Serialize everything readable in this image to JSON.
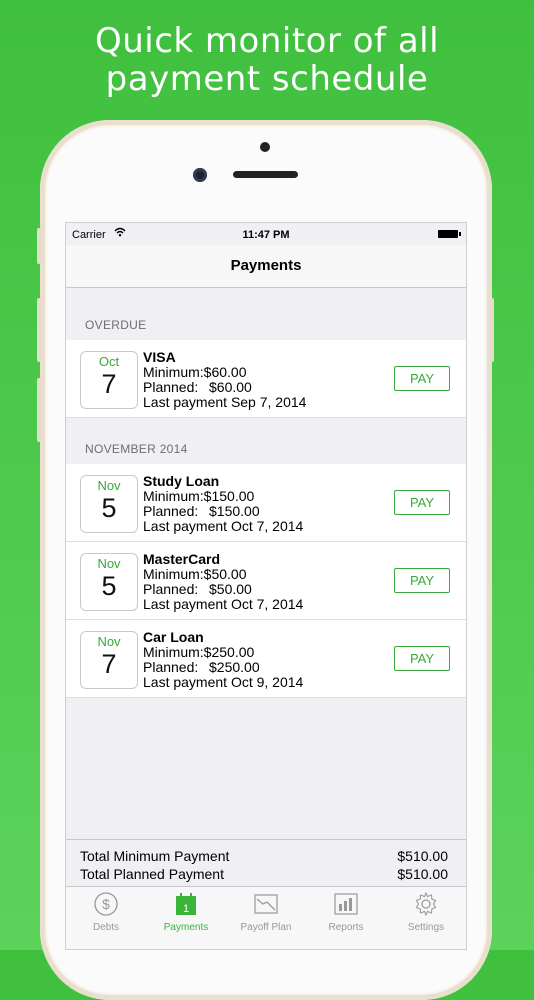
{
  "headline": [
    "Quick monitor of all",
    "payment schedule"
  ],
  "status": {
    "carrier": "Carrier",
    "time": "11:47 PM"
  },
  "nav_title": "Payments",
  "sections": [
    {
      "header": "OVERDUE",
      "items": [
        {
          "month": "Oct",
          "day": "7",
          "name": "VISA",
          "min_label": "Minimum:",
          "min": "$60.00",
          "plan_label": "Planned:",
          "plan": "$60.00",
          "last": "Last payment Sep 7, 2014",
          "pay": "PAY"
        }
      ]
    },
    {
      "header": "NOVEMBER 2014",
      "items": [
        {
          "month": "Nov",
          "day": "5",
          "name": "Study Loan",
          "min_label": "Minimum:",
          "min": "$150.00",
          "plan_label": "Planned:",
          "plan": "$150.00",
          "last": "Last payment Oct 7, 2014",
          "pay": "PAY"
        },
        {
          "month": "Nov",
          "day": "5",
          "name": "MasterCard",
          "min_label": "Minimum:",
          "min": "$50.00",
          "plan_label": "Planned:",
          "plan": "$50.00",
          "last": "Last payment Oct 7, 2014",
          "pay": "PAY"
        },
        {
          "month": "Nov",
          "day": "7",
          "name": "Car Loan",
          "min_label": "Minimum:",
          "min": "$250.00",
          "plan_label": "Planned:",
          "plan": "$250.00",
          "last": "Last payment Oct 9, 2014",
          "pay": "PAY"
        }
      ]
    }
  ],
  "totals": {
    "min_label": "Total Minimum Payment",
    "min_value": "$510.00",
    "plan_label": "Total Planned Payment",
    "plan_value": "$510.00"
  },
  "tabs": [
    {
      "label": "Debts",
      "icon": "dollar-icon",
      "active": false
    },
    {
      "label": "Payments",
      "icon": "calendar-icon",
      "icon_text": "1",
      "active": true
    },
    {
      "label": "Payoff Plan",
      "icon": "trend-chart-icon",
      "active": false
    },
    {
      "label": "Reports",
      "icon": "bar-chart-icon",
      "active": false
    },
    {
      "label": "Settings",
      "icon": "gear-icon",
      "active": false
    }
  ],
  "colors": {
    "accent": "#3aa83a",
    "background": "#46c444"
  }
}
